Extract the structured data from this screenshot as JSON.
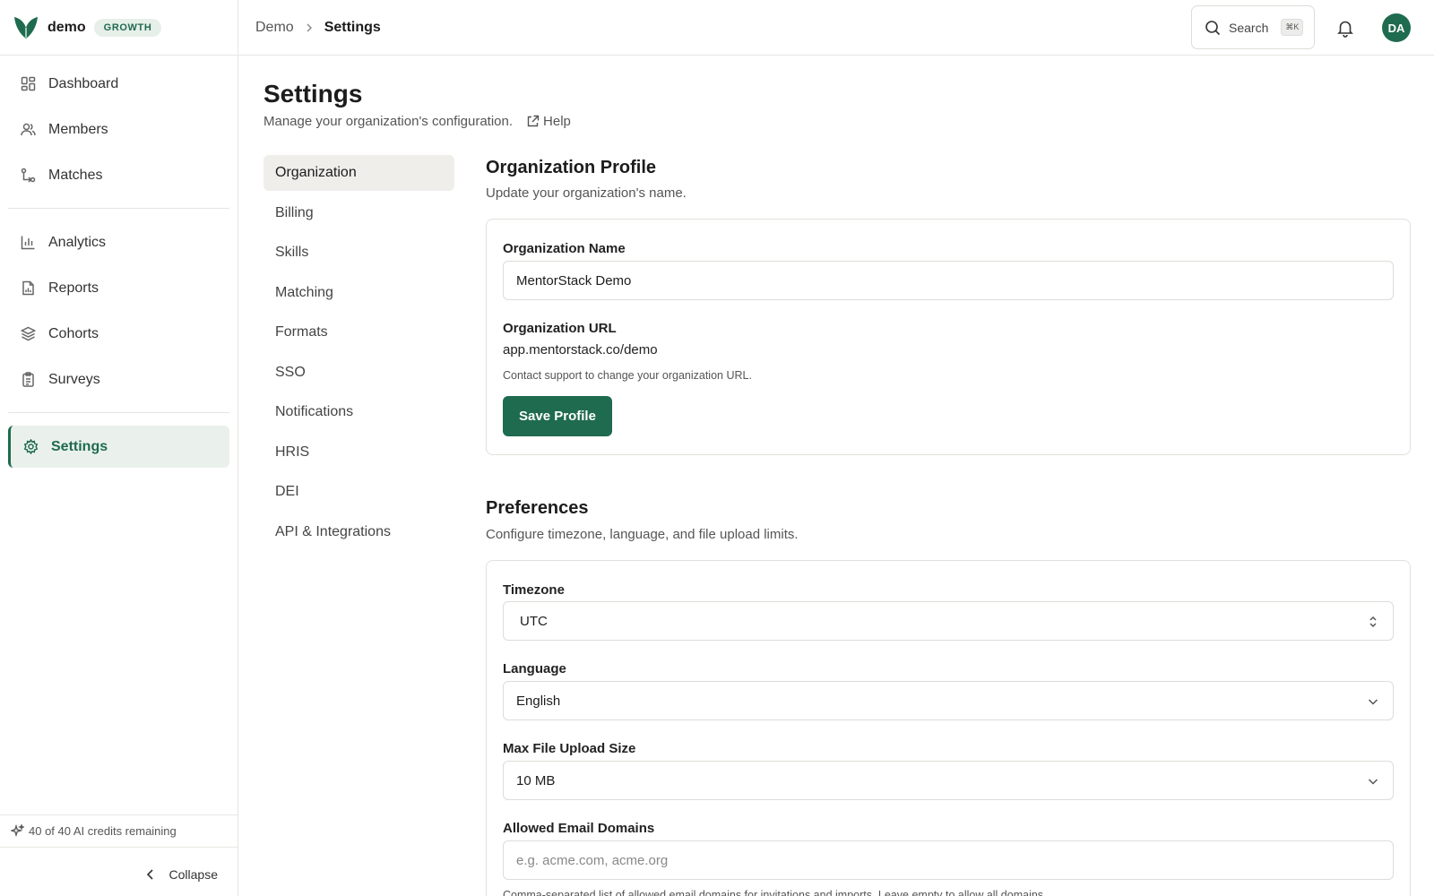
{
  "brand": {
    "name": "demo",
    "plan": "GROWTH"
  },
  "sidebar": {
    "primary": [
      {
        "label": "Dashboard",
        "icon": "dashboard-icon"
      },
      {
        "label": "Members",
        "icon": "users-icon"
      },
      {
        "label": "Matches",
        "icon": "git-match-icon"
      }
    ],
    "secondary": [
      {
        "label": "Analytics",
        "icon": "bar-chart-icon"
      },
      {
        "label": "Reports",
        "icon": "file-chart-icon"
      },
      {
        "label": "Cohorts",
        "icon": "layers-icon"
      },
      {
        "label": "Surveys",
        "icon": "clipboard-icon"
      }
    ],
    "active": {
      "label": "Settings",
      "icon": "gear-icon"
    },
    "credits": "40 of 40 AI credits remaining",
    "collapse_label": "Collapse"
  },
  "topbar": {
    "breadcrumb_parent": "Demo",
    "breadcrumb_current": "Settings",
    "search_label": "Search",
    "search_shortcut": "⌘K",
    "avatar_initials": "DA"
  },
  "page": {
    "title": "Settings",
    "subtitle": "Manage your organization's configuration.",
    "help_label": "Help"
  },
  "settings_nav": [
    "Organization",
    "Billing",
    "Skills",
    "Matching",
    "Formats",
    "SSO",
    "Notifications",
    "HRIS",
    "DEI",
    "API & Integrations"
  ],
  "org_profile": {
    "title": "Organization Profile",
    "subtitle": "Update your organization's name.",
    "name_label": "Organization Name",
    "name_value": "MentorStack Demo",
    "url_label": "Organization URL",
    "url_value": "app.mentorstack.co/demo",
    "url_help": "Contact support to change your organization URL.",
    "save_label": "Save Profile"
  },
  "preferences": {
    "title": "Preferences",
    "subtitle": "Configure timezone, language, and file upload limits.",
    "timezone_label": "Timezone",
    "timezone_value": "UTC",
    "language_label": "Language",
    "language_value": "English",
    "upload_label": "Max File Upload Size",
    "upload_value": "10 MB",
    "domains_label": "Allowed Email Domains",
    "domains_placeholder": "e.g. acme.com, acme.org",
    "domains_help": "Comma-separated list of allowed email domains for invitations and imports. Leave empty to allow all domains."
  },
  "colors": {
    "accent": "#1f6b4f",
    "active_bg": "#eaf1ec",
    "badge_bg": "#e7efe9"
  }
}
